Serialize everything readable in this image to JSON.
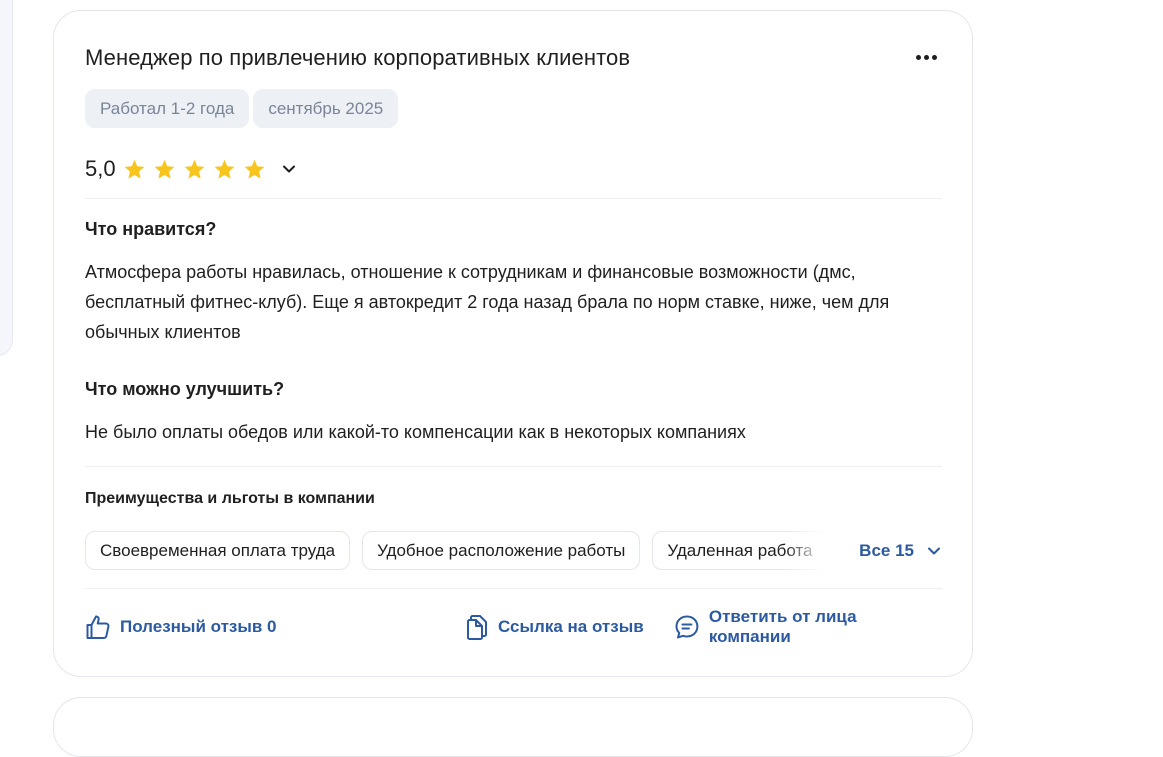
{
  "review": {
    "title": "Менеджер по привлечению корпоративных клиентов",
    "tags": [
      "Работал 1-2 года",
      "сентябрь 2025"
    ],
    "rating_value": "5,0",
    "rating_stars": 5,
    "star_color": "#f7c51e",
    "pros_heading": "Что нравится?",
    "pros_text": "Атмосфера работы нравилась, отношение к сотрудникам и финансовые возможности (дмс, бесплатный фитнес-клуб). Еще я автокредит 2 года назад брала по норм ставке, ниже, чем для обычных клиентов",
    "cons_heading": "Что можно улучшить?",
    "cons_text": "Не было оплаты обедов или какой-то компенсации как в некоторых компаниях"
  },
  "benefits": {
    "heading": "Преимущества и льготы в компании",
    "items": [
      "Своевременная оплата труда",
      "Удобное расположение работы",
      "Удаленная работа"
    ],
    "all_label": "Все 15"
  },
  "actions": {
    "helpful_label": "Полезный отзыв 0",
    "link_label": "Ссылка на отзыв",
    "reply_label": "Ответить от лица компании"
  },
  "icons": {
    "more": "more-horizontal-icon",
    "star": "star-icon",
    "rating_expand": "chevron-down-icon",
    "helpful": "thumbs-up-icon",
    "link": "copy-icon",
    "reply": "chat-icon"
  },
  "colors": {
    "accent": "#2c5aa0",
    "tag_bg": "#edf0f5",
    "tag_text": "#7b8596"
  }
}
